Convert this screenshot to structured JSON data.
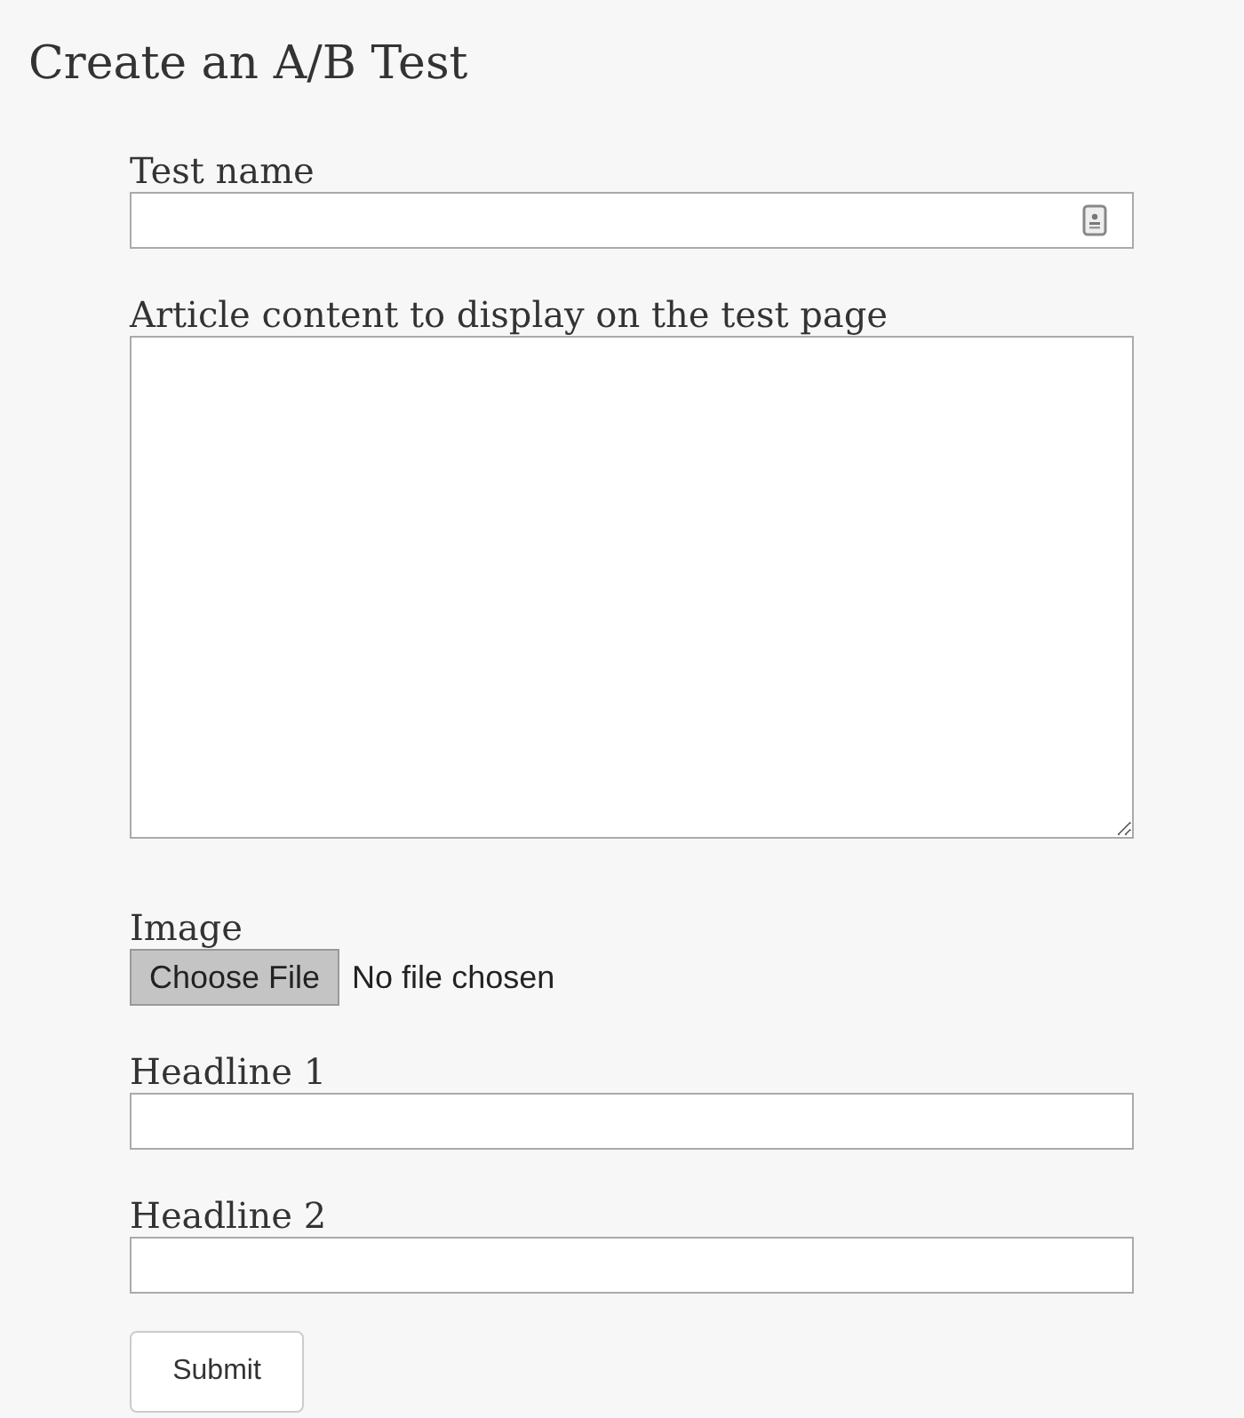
{
  "title": "Create an A/B Test",
  "fields": [
    {
      "kind": "text",
      "label": "Test name",
      "autofill_icon": true
    },
    {
      "kind": "textarea",
      "label": "Article content to display on the test page"
    },
    {
      "kind": "file",
      "label": "Image",
      "button": "Choose File",
      "status": "No file chosen"
    },
    {
      "kind": "text",
      "label": "Headline 1",
      "autofill_icon": false
    },
    {
      "kind": "text",
      "label": "Headline 2",
      "autofill_icon": false
    }
  ],
  "submit": "Submit"
}
